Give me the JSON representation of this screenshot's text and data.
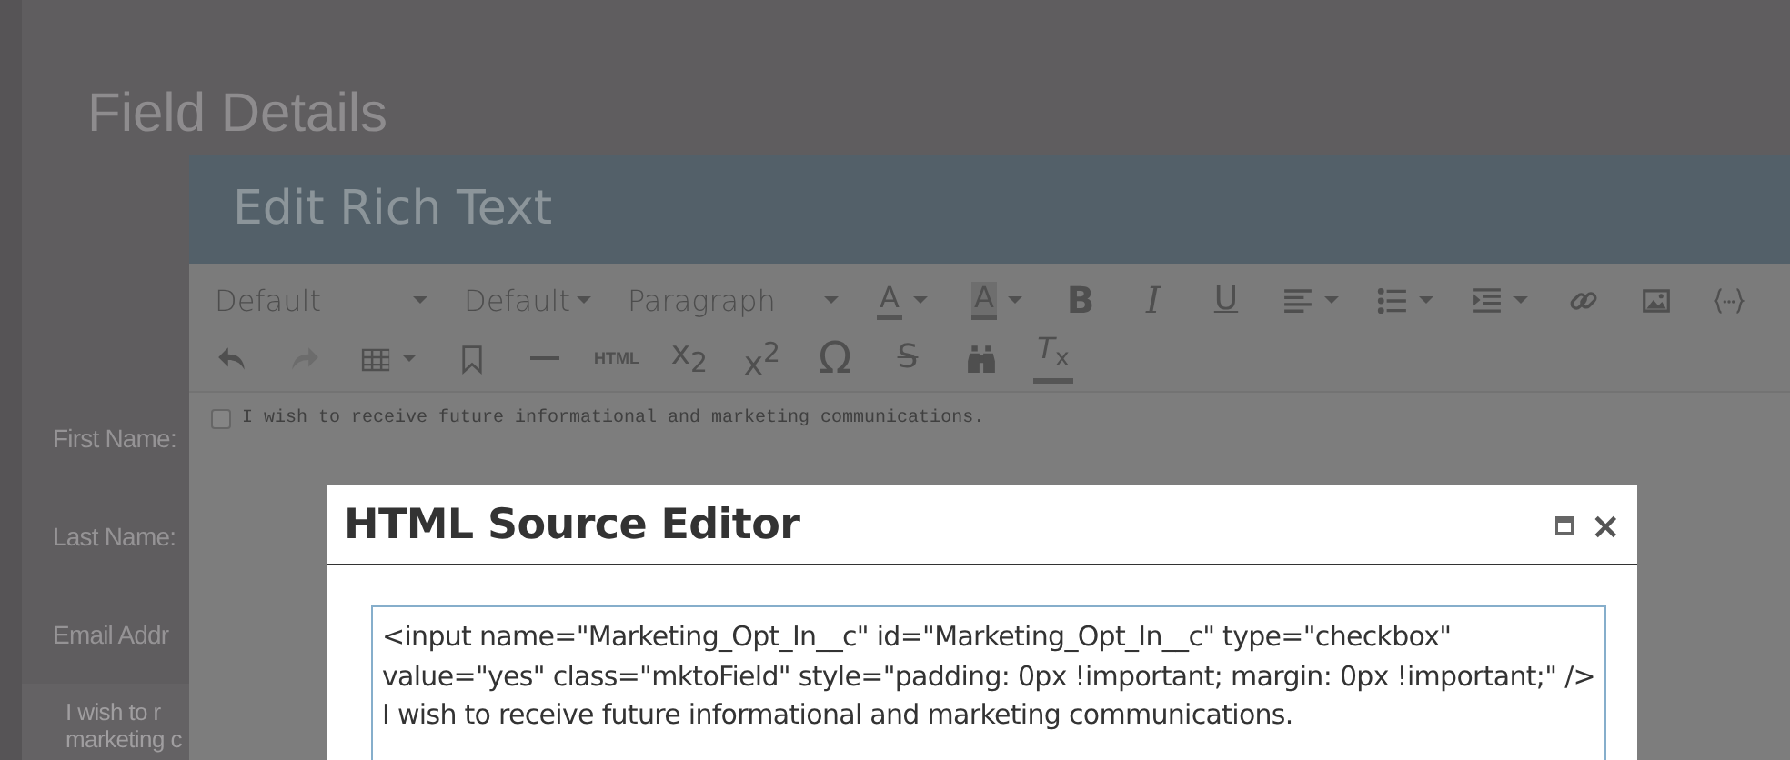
{
  "background": {
    "title": "Field Details",
    "labels": [
      "First Name:",
      "Last Name:",
      "Email Addr"
    ],
    "note_lines": [
      "I wish to r",
      "marketing c"
    ]
  },
  "rich_text_dialog": {
    "title": "Edit Rich Text",
    "toolbar_rows": [
      [
        {
          "kind": "select",
          "value": "Default"
        },
        {
          "kind": "select",
          "value": "Default"
        },
        {
          "kind": "select",
          "value": "Paragraph"
        },
        {
          "kind": "split",
          "label": "A",
          "disabled": false
        },
        {
          "kind": "split",
          "label": "A",
          "disabled": false
        },
        {
          "kind": "button",
          "label": "B",
          "disabled": false
        },
        {
          "kind": "button",
          "label": "I",
          "disabled": false
        },
        {
          "kind": "button",
          "label": "U",
          "disabled": false
        },
        {
          "kind": "split",
          "disabled": false
        },
        {
          "kind": "split",
          "disabled": false
        },
        {
          "kind": "split",
          "disabled": false
        },
        {
          "kind": "button",
          "disabled": false
        },
        {
          "kind": "button",
          "disabled": false
        },
        {
          "kind": "button",
          "disabled": false
        }
      ],
      [
        {
          "kind": "button",
          "disabled": false
        },
        {
          "kind": "button",
          "disabled": true
        },
        {
          "kind": "split",
          "disabled": false
        },
        {
          "kind": "button",
          "disabled": false
        },
        {
          "kind": "button",
          "disabled": false
        },
        {
          "kind": "button",
          "label": "HTML",
          "disabled": false
        },
        {
          "kind": "button",
          "label": "x$_{2}$",
          "disabled": false
        },
        {
          "kind": "button",
          "label": "x$^{2}$",
          "disabled": false
        },
        {
          "kind": "button",
          "label": "Ω",
          "disabled": false
        },
        {
          "kind": "button",
          "label": "S",
          "disabled": false
        },
        {
          "kind": "button",
          "disabled": false
        },
        {
          "kind": "button",
          "label": "*T*$_{x}$",
          "disabled": false
        }
      ]
    ],
    "content": {
      "checked": false,
      "text": "I wish to receive future informational and marketing communications."
    }
  },
  "source_editor": {
    "title": "HTML Source Editor",
    "close": "×",
    "lines": [
      "<input name=\"Marketing_Opt_In__c\" id=\"Marketing_Opt_In__c\" type=\"checkbox\"",
      "value=\"yes\" class=\"mktoField\" style=\"padding: 0px !important; margin: 0px !important;\" />",
      "I wish to receive future informational and marketing communications."
    ]
  }
}
